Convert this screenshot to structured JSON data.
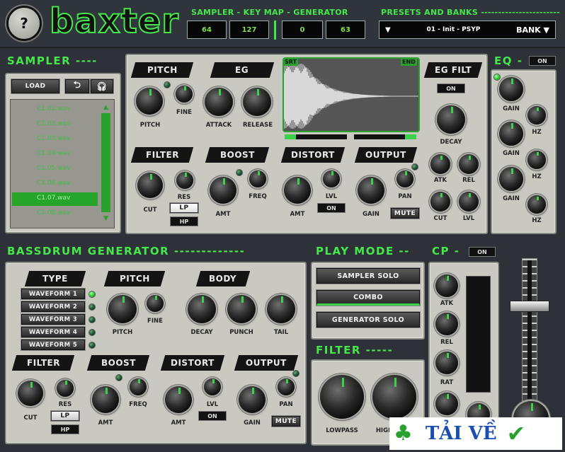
{
  "header": {
    "help_label": "?",
    "logo": "baxter",
    "sampler_label": "SAMPLER -  KEY MAP - GENERATOR",
    "lcd_values": [
      "64",
      "127",
      "0",
      "63"
    ],
    "presets_label": "PRESETS AND BANKS -----------------------",
    "preset_arrow": "▼",
    "preset_name": "01 - Init - PSYP",
    "bank_label": "BANK ▼"
  },
  "sampler": {
    "title": "SAMPLER ----",
    "load_label": "LOAD",
    "files": [
      "C1.01.wav",
      "C1.02.wav",
      "C1.03.wav",
      "C1.04.wav",
      "C1.05.wav",
      "C1.06.wav",
      "C1.07.wav",
      "C1.08.wav"
    ],
    "selected_index": 6,
    "tabs": {
      "pitch": "PITCH",
      "eg": "EG",
      "filter": "FILTER",
      "boost": "BOOST",
      "distort": "DISTORT",
      "output": "OUTPUT",
      "egfilt": "EG FILT"
    },
    "knob_labels": {
      "pitch": "PITCH",
      "fine": "FINE",
      "attack": "ATTACK",
      "release": "RELEASE",
      "cut": "CUT",
      "res": "RES",
      "amt": "AMT",
      "freq": "FREQ",
      "amt2": "AMT",
      "lvl": "LVL",
      "gain": "GAIN",
      "pan": "PAN",
      "decay": "DECAY",
      "atk": "ATK",
      "rel": "REL",
      "cut2": "CUT",
      "lvl2": "LVL"
    },
    "wave_start": "SRT",
    "wave_end": "END",
    "lp": "LP",
    "hp": "HP",
    "on": "ON",
    "mute": "MUTE"
  },
  "eq": {
    "title": "EQ -",
    "on": "ON",
    "labels": [
      "GAIN",
      "HZ",
      "GAIN",
      "HZ",
      "GAIN",
      "HZ"
    ]
  },
  "bassdrum": {
    "title": "BASSDRUM GENERATOR -------------",
    "tabs": {
      "type": "TYPE",
      "pitch": "PITCH",
      "body": "BODY",
      "filter": "FILTER",
      "boost": "BOOST",
      "distort": "DISTORT",
      "output": "OUTPUT"
    },
    "waveforms": [
      "WAVEFORM 1",
      "WAVEFORM 2",
      "WAVEFORM 3",
      "WAVEFORM 4",
      "WAVEFORM 5"
    ],
    "knob_labels": {
      "pitch": "PITCH",
      "fine": "FINE",
      "decay": "DECAY",
      "punch": "PUNCH",
      "tail": "TAIL",
      "cut": "CUT",
      "res": "RES",
      "amt": "AMT",
      "freq": "FREQ",
      "amt2": "AMT",
      "lvl": "LVL",
      "gain": "GAIN",
      "pan": "PAN"
    },
    "lp": "LP",
    "hp": "HP",
    "on": "ON",
    "mute": "MUTE"
  },
  "playmode": {
    "title": "PLAY MODE --",
    "modes": [
      "SAMPLER SOLO",
      "COMBO",
      "GENERATOR SOLO"
    ],
    "active": 1
  },
  "cp": {
    "title": "CP -",
    "on": "ON",
    "labels": [
      "ATK",
      "REL",
      "RAT"
    ]
  },
  "filter": {
    "title": "FILTER -----",
    "lowpass": "LOWPASS",
    "highpass": "HIGH"
  },
  "watermark": {
    "text": "TẢI VỀ"
  }
}
